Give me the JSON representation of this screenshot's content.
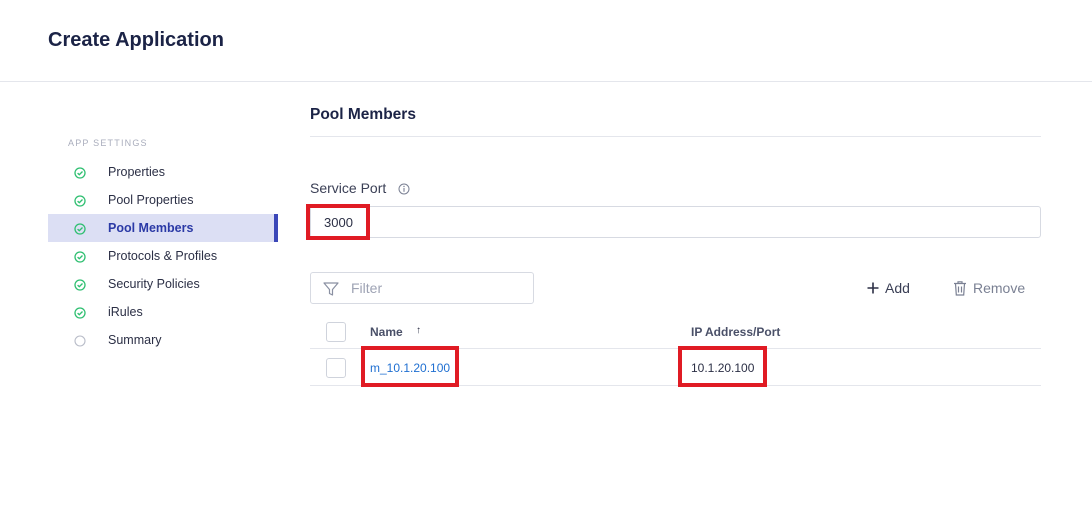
{
  "header": {
    "title": "Create Application"
  },
  "sidebar": {
    "section_label": "APP SETTINGS",
    "items": [
      {
        "label": "Properties",
        "status": "complete"
      },
      {
        "label": "Pool Properties",
        "status": "complete"
      },
      {
        "label": "Pool Members",
        "status": "complete",
        "active": true
      },
      {
        "label": "Protocols & Profiles",
        "status": "complete"
      },
      {
        "label": "Security Policies",
        "status": "complete"
      },
      {
        "label": "iRules",
        "status": "complete"
      },
      {
        "label": "Summary",
        "status": "pending"
      }
    ]
  },
  "main": {
    "section_title": "Pool Members",
    "service_port": {
      "label": "Service Port",
      "value": "3000"
    },
    "filter": {
      "placeholder": "Filter"
    },
    "toolbar": {
      "add_label": "Add",
      "remove_label": "Remove"
    },
    "table": {
      "columns": [
        "Name",
        "IP Address/Port"
      ],
      "sort_indicator": "↑",
      "rows": [
        {
          "name": "m_10.1.20.100",
          "ip": "10.1.20.100"
        }
      ]
    }
  },
  "colors": {
    "success": "#2fbf71",
    "accent": "#3b47b8",
    "link": "#1f6fd1",
    "highlight": "#e01b24"
  }
}
